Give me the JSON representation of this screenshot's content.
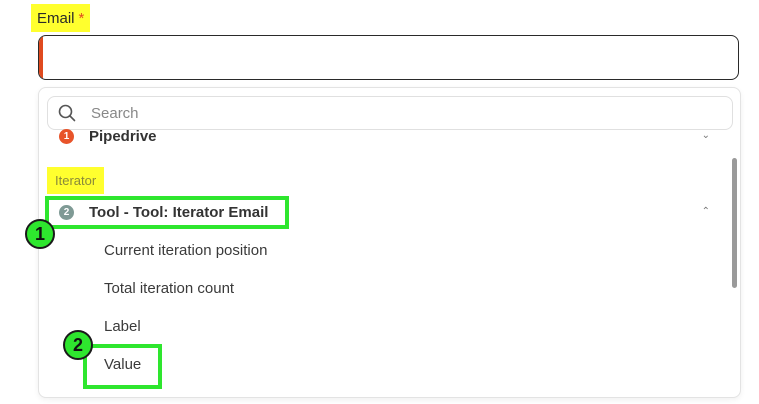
{
  "field": {
    "label": "Email",
    "required_mark": "*",
    "value": ""
  },
  "search": {
    "placeholder": "Search"
  },
  "groups": [
    {
      "badge": "1",
      "name": "Pipedrive",
      "badge_color": "#e8542a",
      "expanded": false
    },
    {
      "badge": "2",
      "name": "Tool - Tool: Iterator Email",
      "badge_color": "#7f9a95",
      "expanded": true
    }
  ],
  "section_label": "Iterator",
  "items": [
    "Current iteration position",
    "Total iteration count",
    "Label",
    "Value"
  ],
  "callouts": [
    "1",
    "2"
  ],
  "colors": {
    "highlight_yellow": "#ffff2e",
    "annotation_green": "#2ee62e",
    "accent_orange": "#e04a1f"
  }
}
